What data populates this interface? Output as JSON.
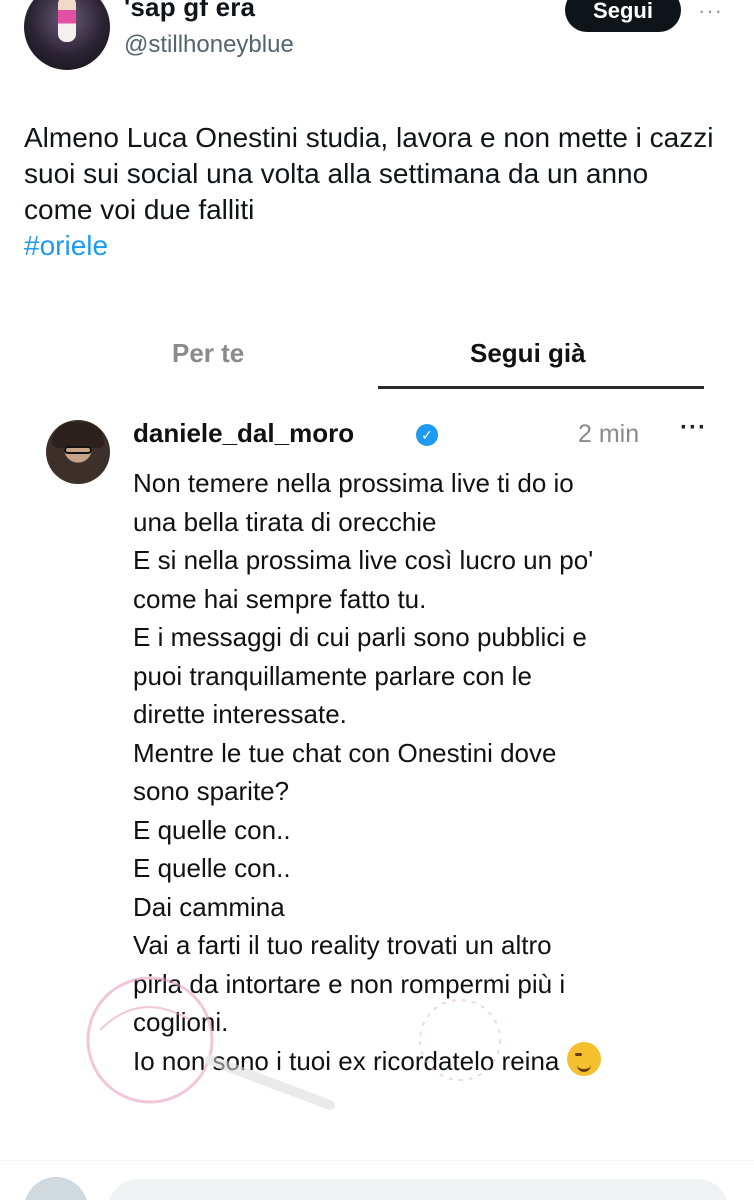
{
  "header": {
    "display_name": "'sap gf era",
    "handle": "@stillhoneyblue",
    "follow_label": "Segui",
    "more_label": "···"
  },
  "tweet": {
    "text": "Almeno Luca Onestini studia, lavora e non mette i cazzi suoi sui social una volta alla settimana da un anno come voi due falliti",
    "hashtag": "#oriele"
  },
  "embedded": {
    "tabs": [
      {
        "label": "Per te",
        "active": false
      },
      {
        "label": "Segui già",
        "active": true
      }
    ],
    "post": {
      "username": "daniele_dal_moro",
      "verified": true,
      "time": "2 min",
      "more_label": "···",
      "lines": [
        "Non temere nella prossima live ti do io",
        "una bella tirata di orecchie",
        "E si nella prossima live così lucro un po'",
        "come hai sempre fatto tu.",
        "E i messaggi di cui parli sono pubblici e",
        "puoi tranquillamente parlare con le",
        "dirette interessate.",
        "Mentre le tue chat con Onestini dove",
        "sono sparite?",
        "E quelle con..",
        "E quelle con..",
        "Dai cammina",
        "Vai a farti il tuo reality trovati un altro",
        "pirla da intortare e non rompermi più i",
        "coglioni.",
        "Io non sono i tuoi ex ricordatelo reina"
      ],
      "emoji": "winking-face"
    }
  },
  "reply_bar": {
    "placeholder": ""
  },
  "colors": {
    "link": "#1d9bf0",
    "text": "#0f1419",
    "muted": "#536471",
    "follow_bg": "#0f1419"
  }
}
